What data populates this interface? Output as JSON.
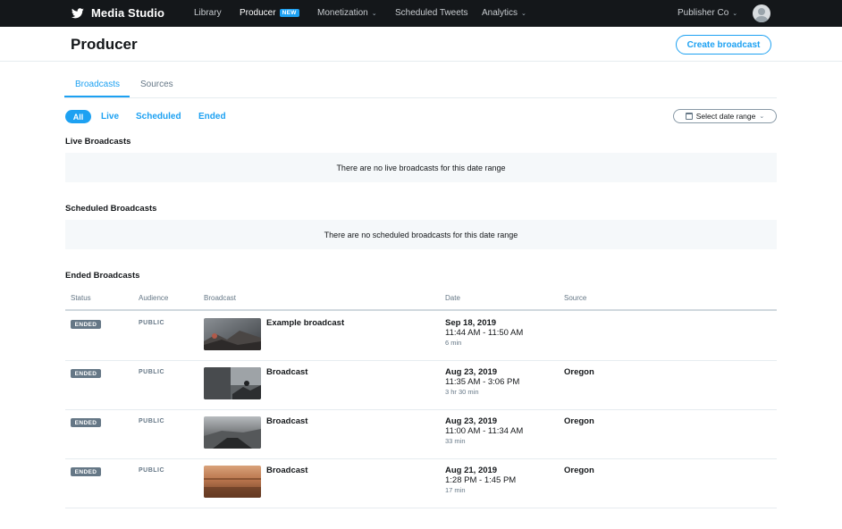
{
  "nav": {
    "brand": "Media Studio",
    "items": [
      {
        "label": "Library"
      },
      {
        "label": "Producer",
        "badge": "NEW"
      },
      {
        "label": "Monetization"
      },
      {
        "label": "Scheduled Tweets"
      },
      {
        "label": "Analytics"
      }
    ],
    "account": "Publisher Co"
  },
  "header": {
    "title": "Producer",
    "create_button": "Create broadcast"
  },
  "tabs": [
    {
      "label": "Broadcasts",
      "active": true
    },
    {
      "label": "Sources",
      "active": false
    }
  ],
  "filters": {
    "options": [
      "All",
      "Live",
      "Scheduled",
      "Ended"
    ],
    "selected": "All",
    "date_range": "Select date range"
  },
  "sections": {
    "live": {
      "title": "Live Broadcasts",
      "empty": "There are no live broadcasts for this date range"
    },
    "scheduled": {
      "title": "Scheduled Broadcasts",
      "empty": "There are no scheduled broadcasts for this date range"
    },
    "ended": {
      "title": "Ended Broadcasts"
    }
  },
  "table": {
    "columns": [
      "Status",
      "Audience",
      "Broadcast",
      "Date",
      "Source"
    ],
    "rows": [
      {
        "status": "ENDED",
        "audience": "PUBLIC",
        "name": "Example broadcast",
        "date": "Sep 18, 2019",
        "time": "11:44 AM - 11:50 AM",
        "duration": "6 min",
        "source": ""
      },
      {
        "status": "ENDED",
        "audience": "PUBLIC",
        "name": "Broadcast",
        "date": "Aug 23, 2019",
        "time": "11:35 AM - 3:06 PM",
        "duration": "3 hr 30 min",
        "source": "Oregon"
      },
      {
        "status": "ENDED",
        "audience": "PUBLIC",
        "name": "Broadcast",
        "date": "Aug 23, 2019",
        "time": "11:00 AM - 11:34 AM",
        "duration": "33 min",
        "source": "Oregon"
      },
      {
        "status": "ENDED",
        "audience": "PUBLIC",
        "name": "Broadcast",
        "date": "Aug 21, 2019",
        "time": "1:28 PM - 1:45 PM",
        "duration": "17 min",
        "source": "Oregon"
      }
    ]
  },
  "colors": {
    "accent": "#1da1f2",
    "nav_bg": "#14171a",
    "badge_bg": "#657786",
    "empty_bg": "#f5f8fa"
  }
}
